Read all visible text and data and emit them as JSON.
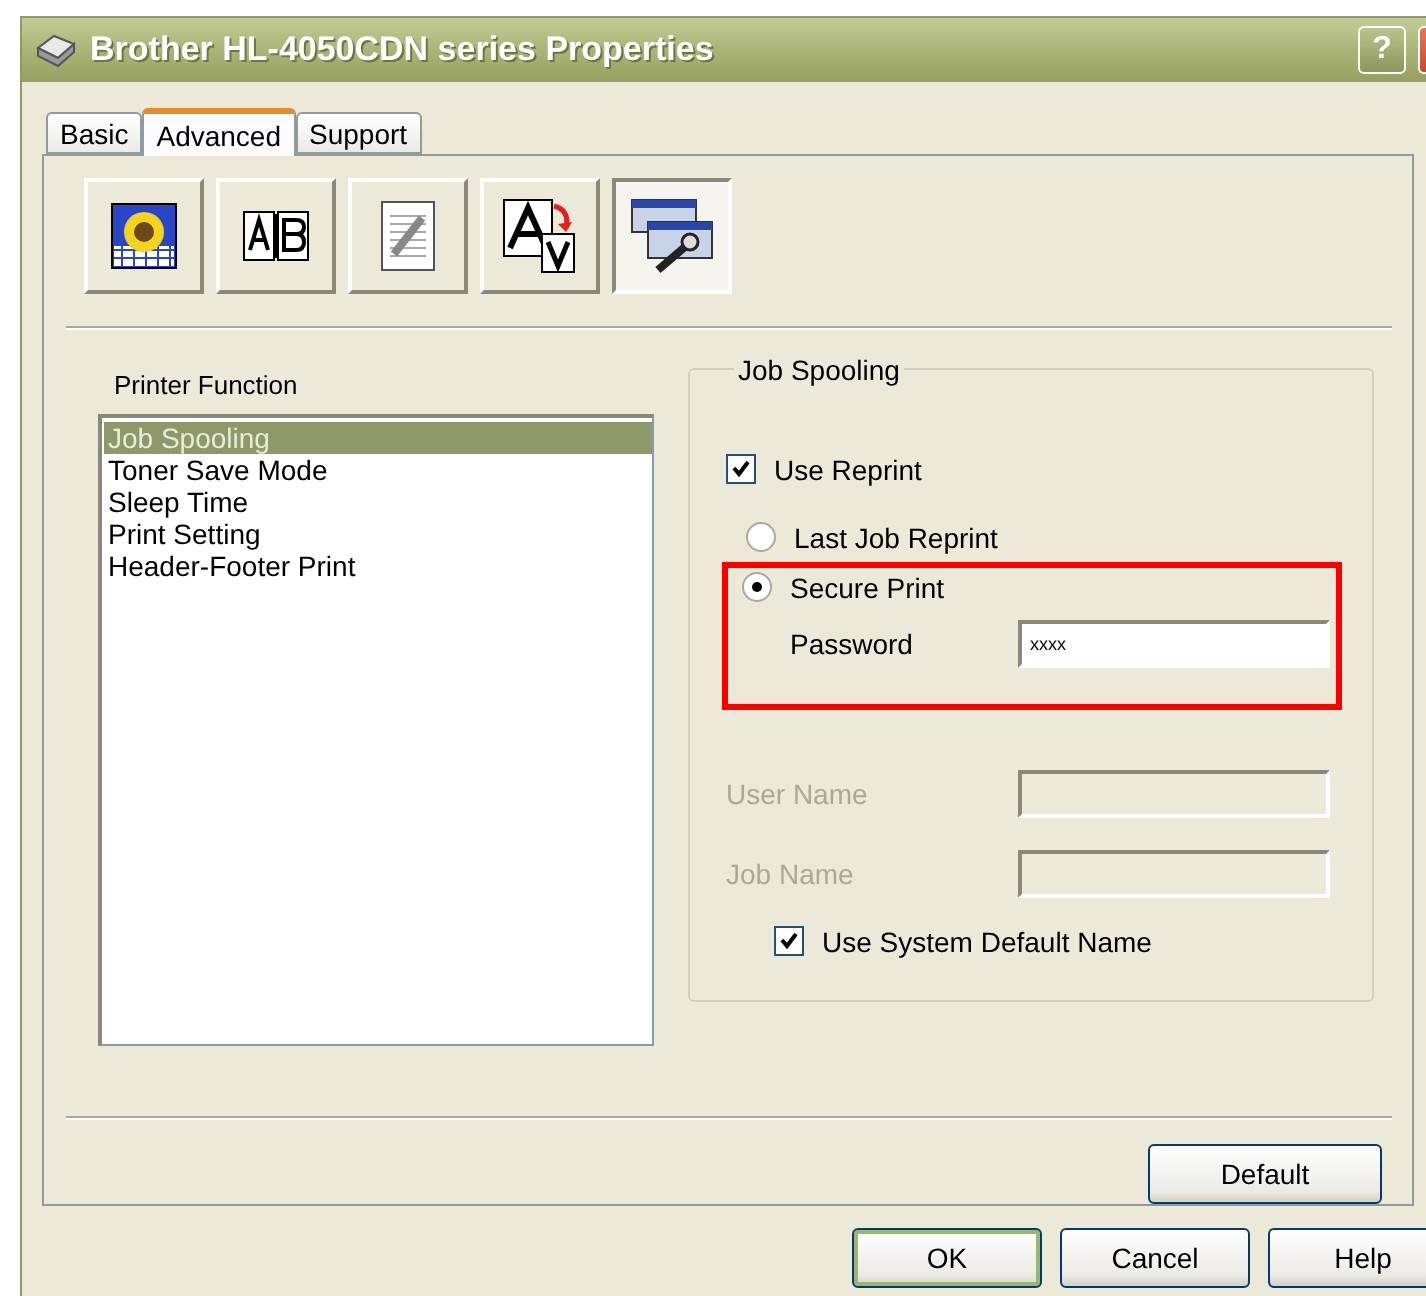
{
  "window": {
    "title": "Brother HL-4050CDN series Properties",
    "help": "?"
  },
  "tabs": [
    {
      "label": "Basic",
      "selected": false
    },
    {
      "label": "Advanced",
      "selected": true
    },
    {
      "label": "Support",
      "selected": false
    }
  ],
  "toolbar": [
    {
      "kind": "sunflower",
      "selected": false
    },
    {
      "kind": "ab",
      "selected": false
    },
    {
      "kind": "copy",
      "selected": false
    },
    {
      "kind": "font",
      "selected": false
    },
    {
      "kind": "windows",
      "selected": true
    }
  ],
  "function_list": {
    "label": "Printer Function",
    "items": [
      {
        "label": "Job Spooling",
        "selected": true
      },
      {
        "label": "Toner Save Mode",
        "selected": false
      },
      {
        "label": "Sleep Time",
        "selected": false
      },
      {
        "label": "Print Setting",
        "selected": false
      },
      {
        "label": "Header-Footer Print",
        "selected": false
      }
    ]
  },
  "job_spooling": {
    "title": "Job Spooling",
    "use_reprint": {
      "label": "Use Reprint",
      "checked": true
    },
    "modes": [
      {
        "label": "Last Job Reprint",
        "selected": false
      },
      {
        "label": "Secure Print",
        "selected": true
      }
    ],
    "highlighted": true,
    "password": {
      "label": "Password",
      "value": "xxxx"
    },
    "user_name": {
      "label": "User Name",
      "disabled": true
    },
    "job_name": {
      "label": "Job Name",
      "disabled": true
    },
    "use_system_default": {
      "label": "Use System Default Name",
      "checked": true
    }
  },
  "default_button": "Default",
  "buttons": [
    {
      "label": "OK",
      "kind": "default"
    },
    {
      "label": "Cancel",
      "kind": "normal"
    },
    {
      "label": "Help",
      "kind": "normal"
    }
  ]
}
